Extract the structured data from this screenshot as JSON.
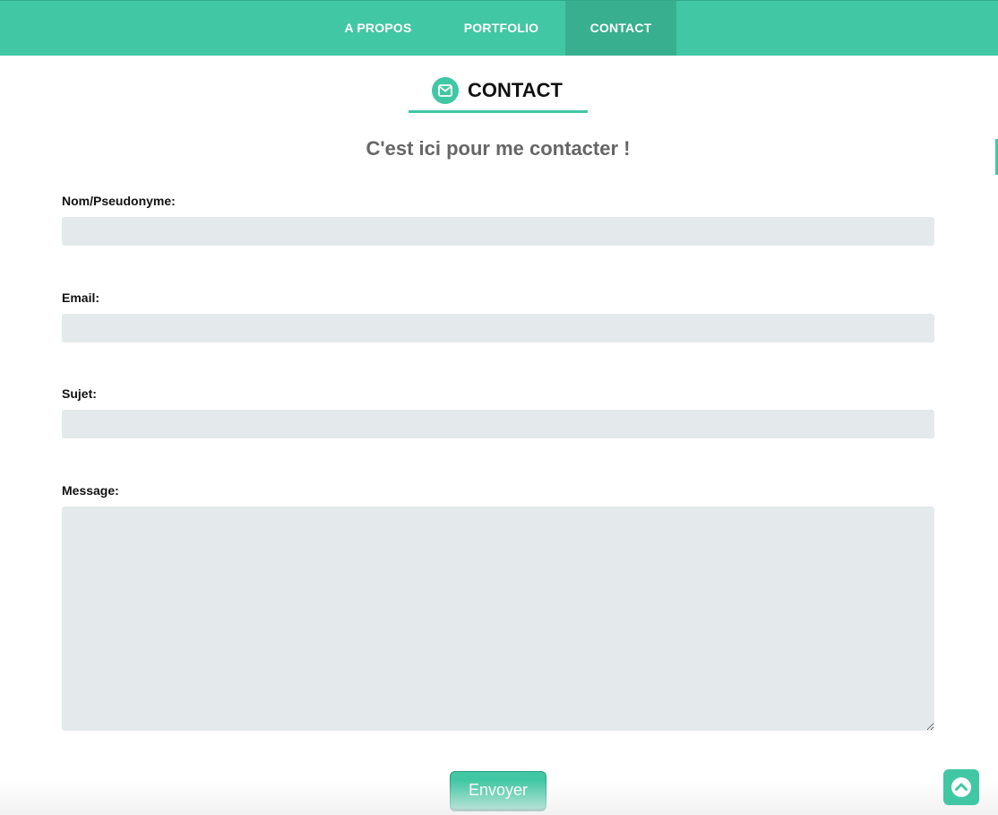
{
  "nav": {
    "items": [
      {
        "label": "A PROPOS"
      },
      {
        "label": "PORTFOLIO"
      },
      {
        "label": "CONTACT"
      }
    ],
    "active": "CONTACT"
  },
  "section": {
    "icon": "envelope-icon",
    "title": "CONTACT",
    "subtitle": "C'est ici pour me contacter !"
  },
  "form": {
    "name_label": "Nom/Pseudonyme:",
    "name_value": "",
    "email_label": "Email:",
    "email_value": "",
    "subject_label": "Sujet:",
    "subject_value": "",
    "message_label": "Message:",
    "message_value": "",
    "submit_label": "Envoyer"
  },
  "scroll_top": {
    "icon": "chevron-up-circle-icon"
  },
  "colors": {
    "accent": "#41c7a3",
    "accent_dark": "#38b08f",
    "input_bg": "#e4e9eb",
    "subtitle": "#666666"
  }
}
